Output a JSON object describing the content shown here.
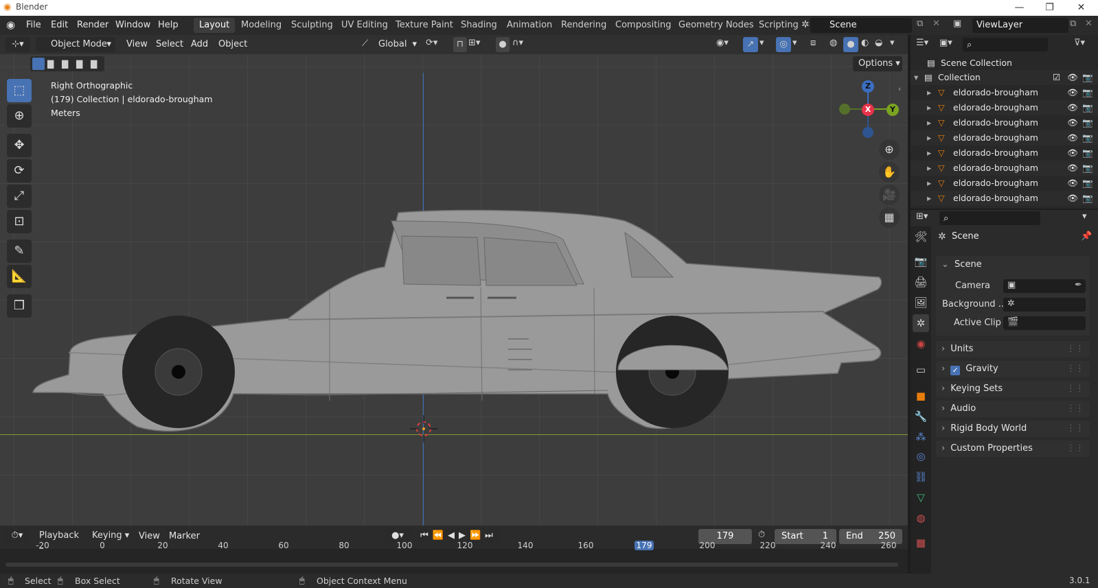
{
  "window": {
    "title": "Blender",
    "version": "3.0.1"
  },
  "menus": [
    "File",
    "Edit",
    "Render",
    "Window",
    "Help"
  ],
  "workspaces": [
    "Layout",
    "Modeling",
    "Sculpting",
    "UV Editing",
    "Texture Paint",
    "Shading",
    "Animation",
    "Rendering",
    "Compositing",
    "Geometry Nodes",
    "Scripting"
  ],
  "active_workspace": "Layout",
  "scene_name": "Scene",
  "view_layer": "ViewLayer",
  "viewport": {
    "mode": "Object Mode",
    "menu": [
      "View",
      "Select",
      "Add",
      "Object"
    ],
    "transform_orientation": "Global",
    "options_label": "Options",
    "info_line1": "Right Orthographic",
    "info_line2": "(179) Collection | eldorado-brougham",
    "info_line3": "Meters",
    "gizmo": {
      "z": "Z",
      "x": "X",
      "y": "Y"
    }
  },
  "outliner": {
    "root": "Scene Collection",
    "collection": "Collection",
    "objects": [
      "eldorado-brougham",
      "eldorado-brougham",
      "eldorado-brougham",
      "eldorado-brougham",
      "eldorado-brougham",
      "eldorado-brougham",
      "eldorado-brougham",
      "eldorado-brougham"
    ]
  },
  "properties": {
    "context": "Scene",
    "panel": "Scene",
    "fields": [
      {
        "label": "Camera"
      },
      {
        "label": "Background ..."
      },
      {
        "label": "Active Clip"
      }
    ],
    "sections": [
      "Units",
      "Gravity",
      "Keying Sets",
      "Audio",
      "Rigid Body World",
      "Custom Properties"
    ],
    "gravity_checked": true
  },
  "timeline": {
    "menus": [
      "Playback",
      "Keying",
      "View",
      "Marker"
    ],
    "current_frame": "179",
    "start_label": "Start",
    "start": "1",
    "end_label": "End",
    "end": "250",
    "ticks": [
      "-20",
      "0",
      "20",
      "40",
      "60",
      "80",
      "100",
      "120",
      "140",
      "160",
      "179",
      "200",
      "220",
      "240",
      "260"
    ]
  },
  "status": {
    "select": "Select",
    "box_select": "Box Select",
    "rotate": "Rotate View",
    "context_menu": "Object Context Menu"
  },
  "colors": {
    "accent": "#4772b3",
    "header": "#303030",
    "viewport": "#3d3d3d",
    "orange": "#e87d0d"
  }
}
